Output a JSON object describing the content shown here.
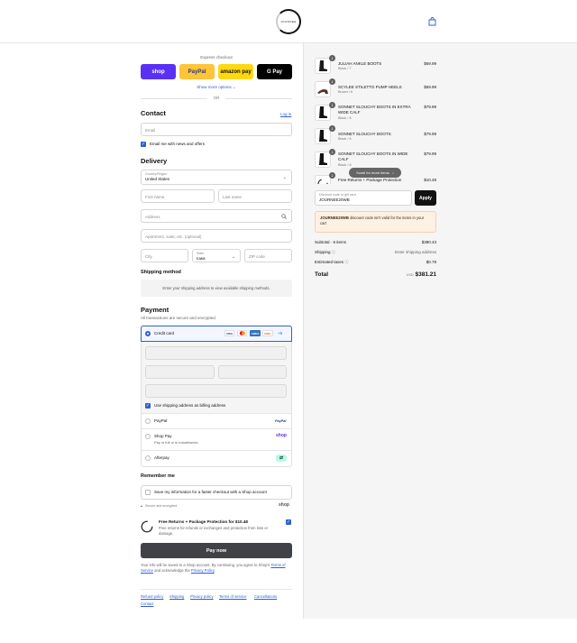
{
  "header": {
    "logo_text": "JOURNEE",
    "cart_icon": "shopping-bag-icon"
  },
  "express": {
    "label": "Express checkout",
    "buttons": [
      {
        "label": "shop",
        "bg": "#5a31f4",
        "color": "#ffffff"
      },
      {
        "label": "PayPal",
        "bg": "#ffc439",
        "color": "#253b80"
      },
      {
        "label": "amazon pay",
        "bg": "#ffd814",
        "color": "#111111"
      },
      {
        "label": "G Pay",
        "bg": "#000000",
        "color": "#ffffff"
      }
    ],
    "show_more": "Show more options ⌄",
    "or": "OR"
  },
  "contact": {
    "title": "Contact",
    "login": "Log in",
    "email_placeholder": "Email",
    "news_label": "Email me with news and offers"
  },
  "delivery": {
    "title": "Delivery",
    "country_label": "Country/Region",
    "country_value": "United States",
    "first_name": "First name",
    "last_name": "Last name",
    "address": "Address",
    "apartment": "Apartment, suite, etc. (optional)",
    "city": "City",
    "state_label": "State",
    "state_value": "Iowa",
    "zip": "ZIP code"
  },
  "shipping": {
    "title": "Shipping method",
    "message": "Enter your shipping address to view available shipping methods."
  },
  "payment": {
    "title": "Payment",
    "subtitle": "All transactions are secure and encrypted.",
    "credit_card": "Credit card",
    "card_more": "+5",
    "use_shipping": "Use shipping address as billing address",
    "paypal": "PayPal",
    "shoppay": "Shop Pay",
    "shoppay_sub": "Pay in full or in installments",
    "afterpay": "Afterpay"
  },
  "remember": {
    "title": "Remember me",
    "save_label": "Save my information for a faster checkout with a Shop account",
    "secure": "Secure and encrypted",
    "shop": "shop"
  },
  "protection": {
    "title": "Free Returns + Package Protection for $10.48",
    "desc": "Free returns for refunds or exchanges and protection from loss or damage."
  },
  "pay_now": "Pay now",
  "legal": {
    "text1": "Your info will be saved to a Shop account. By continuing, you agree to Shop's",
    "terms": "Terms of Service",
    "text2": "and acknowledge the",
    "privacy": "Privacy Policy",
    "end": "."
  },
  "footer_links": [
    "Refund policy",
    "Shipping",
    "Privacy policy",
    "Terms of service",
    "Cancellations",
    "Contact"
  ],
  "cart": {
    "items": [
      {
        "name": "JULIAH ANKLE BOOTS",
        "variant": "Black / 7",
        "price": "$69.99",
        "qty": "1"
      },
      {
        "name": "SCYLEE STILETTO PUMP HEELS",
        "variant": "Brown / 6",
        "price": "$59.99",
        "qty": "1"
      },
      {
        "name": "SONNET SLOUCHY BOOTS IN EXTRA WIDE CALF",
        "variant": "Black / 6",
        "price": "$79.99",
        "qty": "1"
      },
      {
        "name": "SONNET SLOUCHY BOOTS",
        "variant": "Black / 6",
        "price": "$79.99",
        "qty": "1"
      },
      {
        "name": "SONNET SLOUCHY BOOTS IN WIDE CALF",
        "variant": "Black / 6",
        "price": "$79.99",
        "qty": "1"
      },
      {
        "name": "Free Returns + Package Protection",
        "variant": "",
        "price": "$10.48",
        "qty": "1"
      }
    ],
    "scroll_hint": "Scroll for more items",
    "discount_label": "Discount code or gift card",
    "discount_value": "JOURNEE20WB",
    "apply": "Apply",
    "error_code": "JOURNEE20WB",
    "error_text": "discount code isn't valid for the items in your cart",
    "subtotal_label": "Subtotal · 6 items",
    "subtotal": "$380.43",
    "shipping_label": "Shipping",
    "shipping_value": "Enter shipping address",
    "taxes_label": "Estimated taxes",
    "taxes_value": "$0.78",
    "total_label": "Total",
    "currency": "USD",
    "total": "$381.21"
  }
}
